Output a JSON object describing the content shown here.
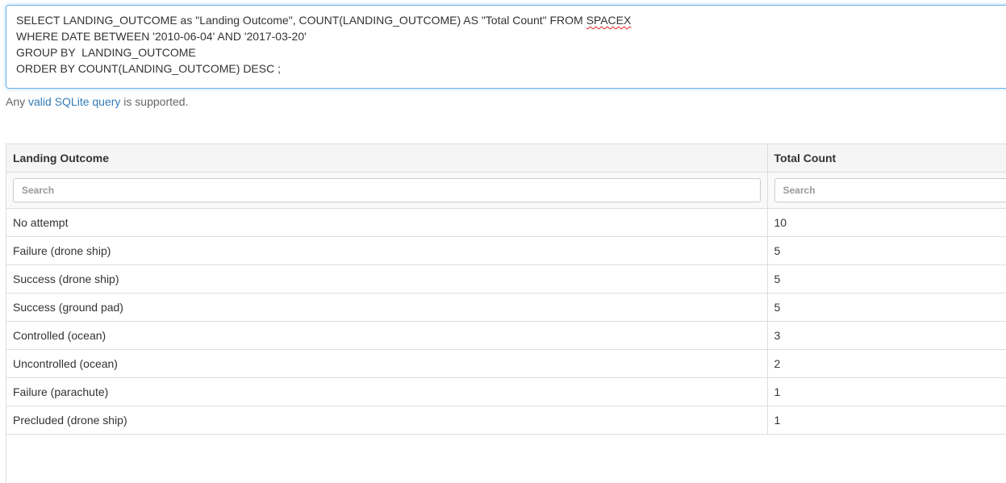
{
  "query": {
    "line1_before": "SELECT LANDING_OUTCOME as \"Landing Outcome\", COUNT(LANDING_OUTCOME) AS \"Total Count\" FROM ",
    "line1_table": "SPACEX",
    "line2": "WHERE DATE BETWEEN '2010-06-04' AND '2017-03-20'",
    "line3": "GROUP BY  LANDING_OUTCOME",
    "line4": "ORDER BY COUNT(LANDING_OUTCOME) DESC ;"
  },
  "help": {
    "prefix": "Any ",
    "link": "valid SQLite query",
    "suffix": " is supported."
  },
  "table": {
    "columns": [
      "Landing Outcome",
      "Total Count"
    ],
    "search_placeholders": [
      "Search",
      "Search"
    ],
    "rows": [
      [
        "No attempt",
        "10"
      ],
      [
        "Failure (drone ship)",
        "5"
      ],
      [
        "Success (drone ship)",
        "5"
      ],
      [
        "Success (ground pad)",
        "5"
      ],
      [
        "Controlled (ocean)",
        "3"
      ],
      [
        "Uncontrolled (ocean)",
        "2"
      ],
      [
        "Failure (parachute)",
        "1"
      ],
      [
        "Precluded (drone ship)",
        "1"
      ]
    ]
  },
  "colors": {
    "link": "#337ab7",
    "focus_border": "#66afe9",
    "spellcheck": "#e02020"
  }
}
